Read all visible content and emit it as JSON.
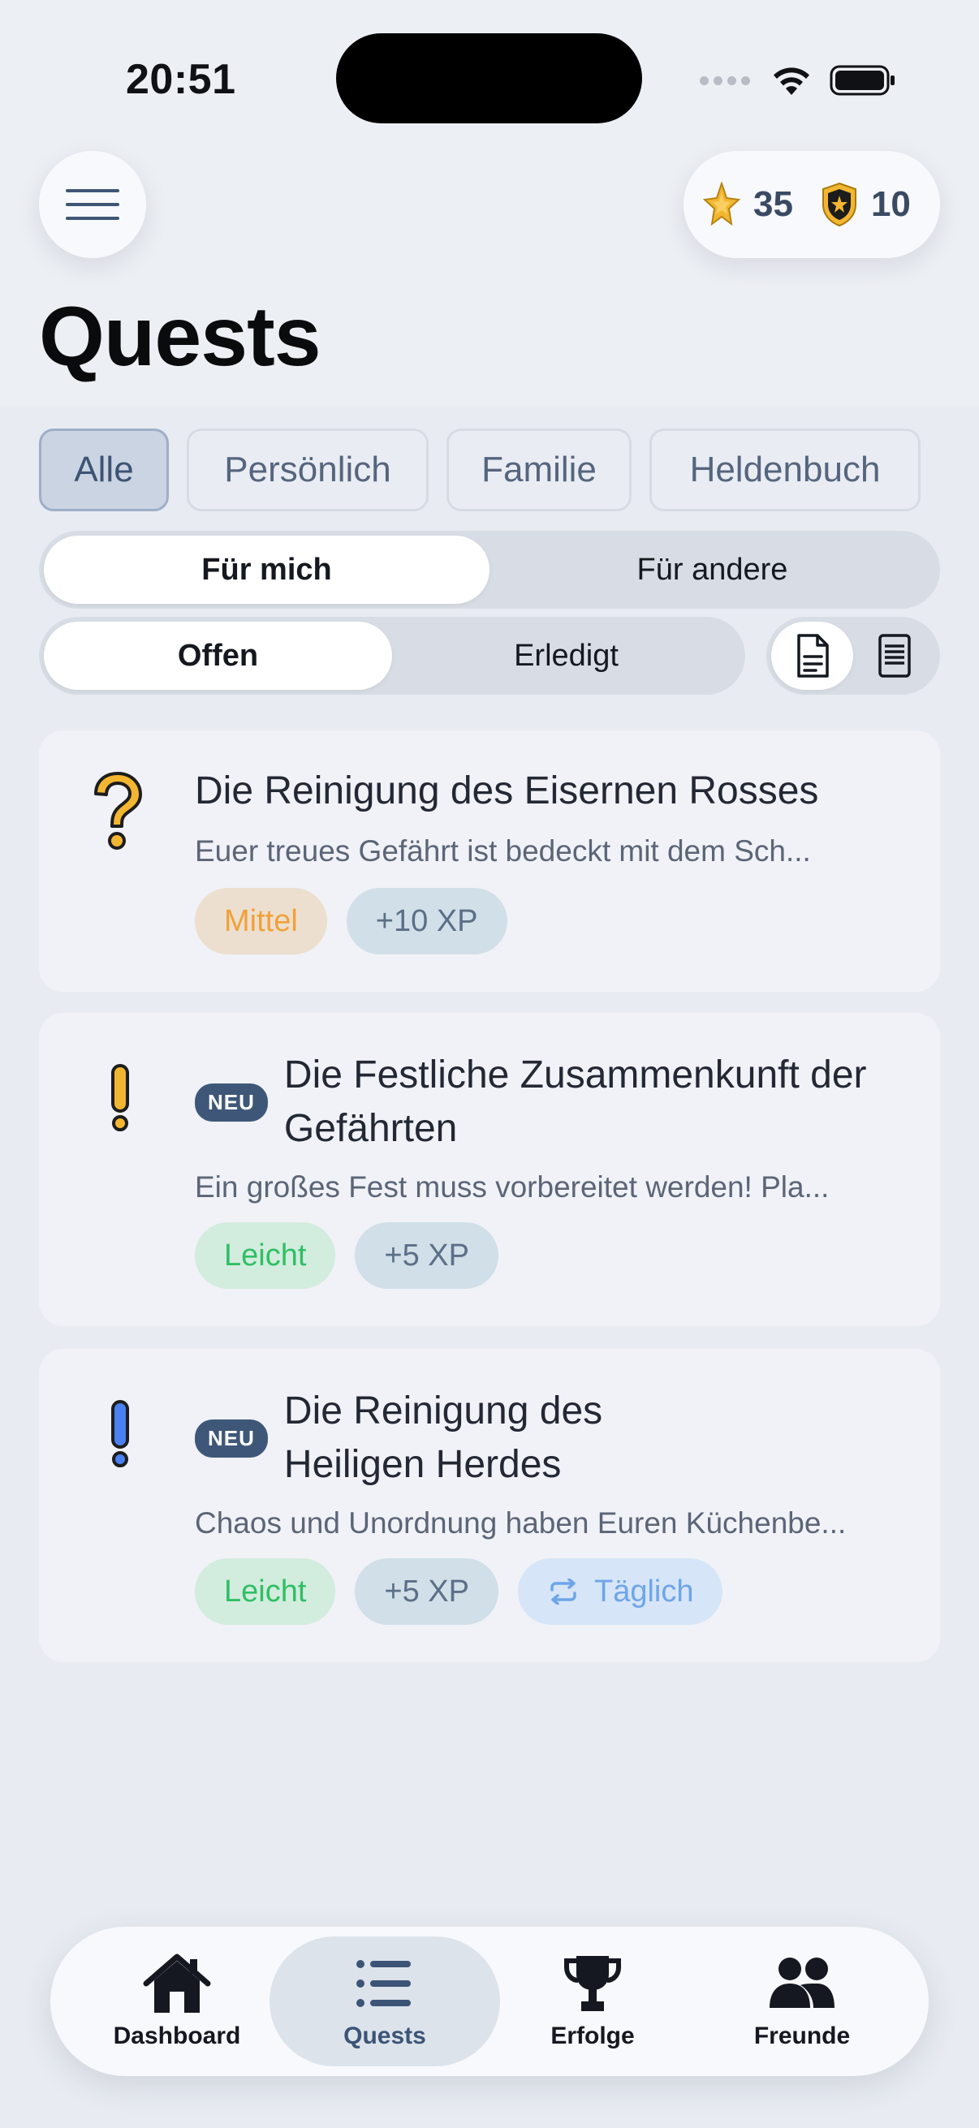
{
  "status_bar": {
    "time": "20:51"
  },
  "header": {
    "stars": "35",
    "shields": "10",
    "title": "Quests"
  },
  "filters": {
    "chips": [
      "Alle",
      "Persönlich",
      "Familie",
      "Heldenbuch"
    ],
    "active": "Alle"
  },
  "target_toggle": {
    "options": [
      "Für mich",
      "Für andere"
    ],
    "active": "Für mich"
  },
  "status_toggle": {
    "options": [
      "Offen",
      "Erledigt"
    ],
    "active": "Offen"
  },
  "view_toggle": {
    "options": [
      "document-icon",
      "list-icon"
    ],
    "active": "document-icon"
  },
  "quests": [
    {
      "icon": "question-mark-icon",
      "new": false,
      "title": "Die Reinigung des Eisernen Rosses",
      "description": "Euer treues Gefährt ist bedeckt mit dem Sch...",
      "tags": [
        "Mittel",
        "+10 XP"
      ]
    },
    {
      "icon": "exclamation-icon",
      "new": true,
      "badge": "NEU",
      "title": "Die Festliche Zusammenkunft der Gefährten",
      "description": "Ein großes Fest muss vorbereitet werden! Pla...",
      "tags": [
        "Leicht",
        "+5 XP"
      ]
    },
    {
      "icon": "exclamation-icon",
      "new": true,
      "badge": "NEU",
      "title": "Die Reinigung des Heiligen Herdes",
      "description": "Chaos und Unordnung haben Euren Küchenbe...",
      "tags": [
        "Leicht",
        "+5 XP",
        "Täglich"
      ]
    }
  ],
  "bottom_nav": {
    "items": [
      "Dashboard",
      "Quests",
      "Erfolge",
      "Freunde"
    ],
    "active": "Quests"
  },
  "colors": {
    "background": "#eceff4",
    "accent": "#3e5779",
    "medium": "#f0a13a",
    "easy": "#2fbf65",
    "daily": "#6ea5ea",
    "gold": "#f2b630"
  }
}
